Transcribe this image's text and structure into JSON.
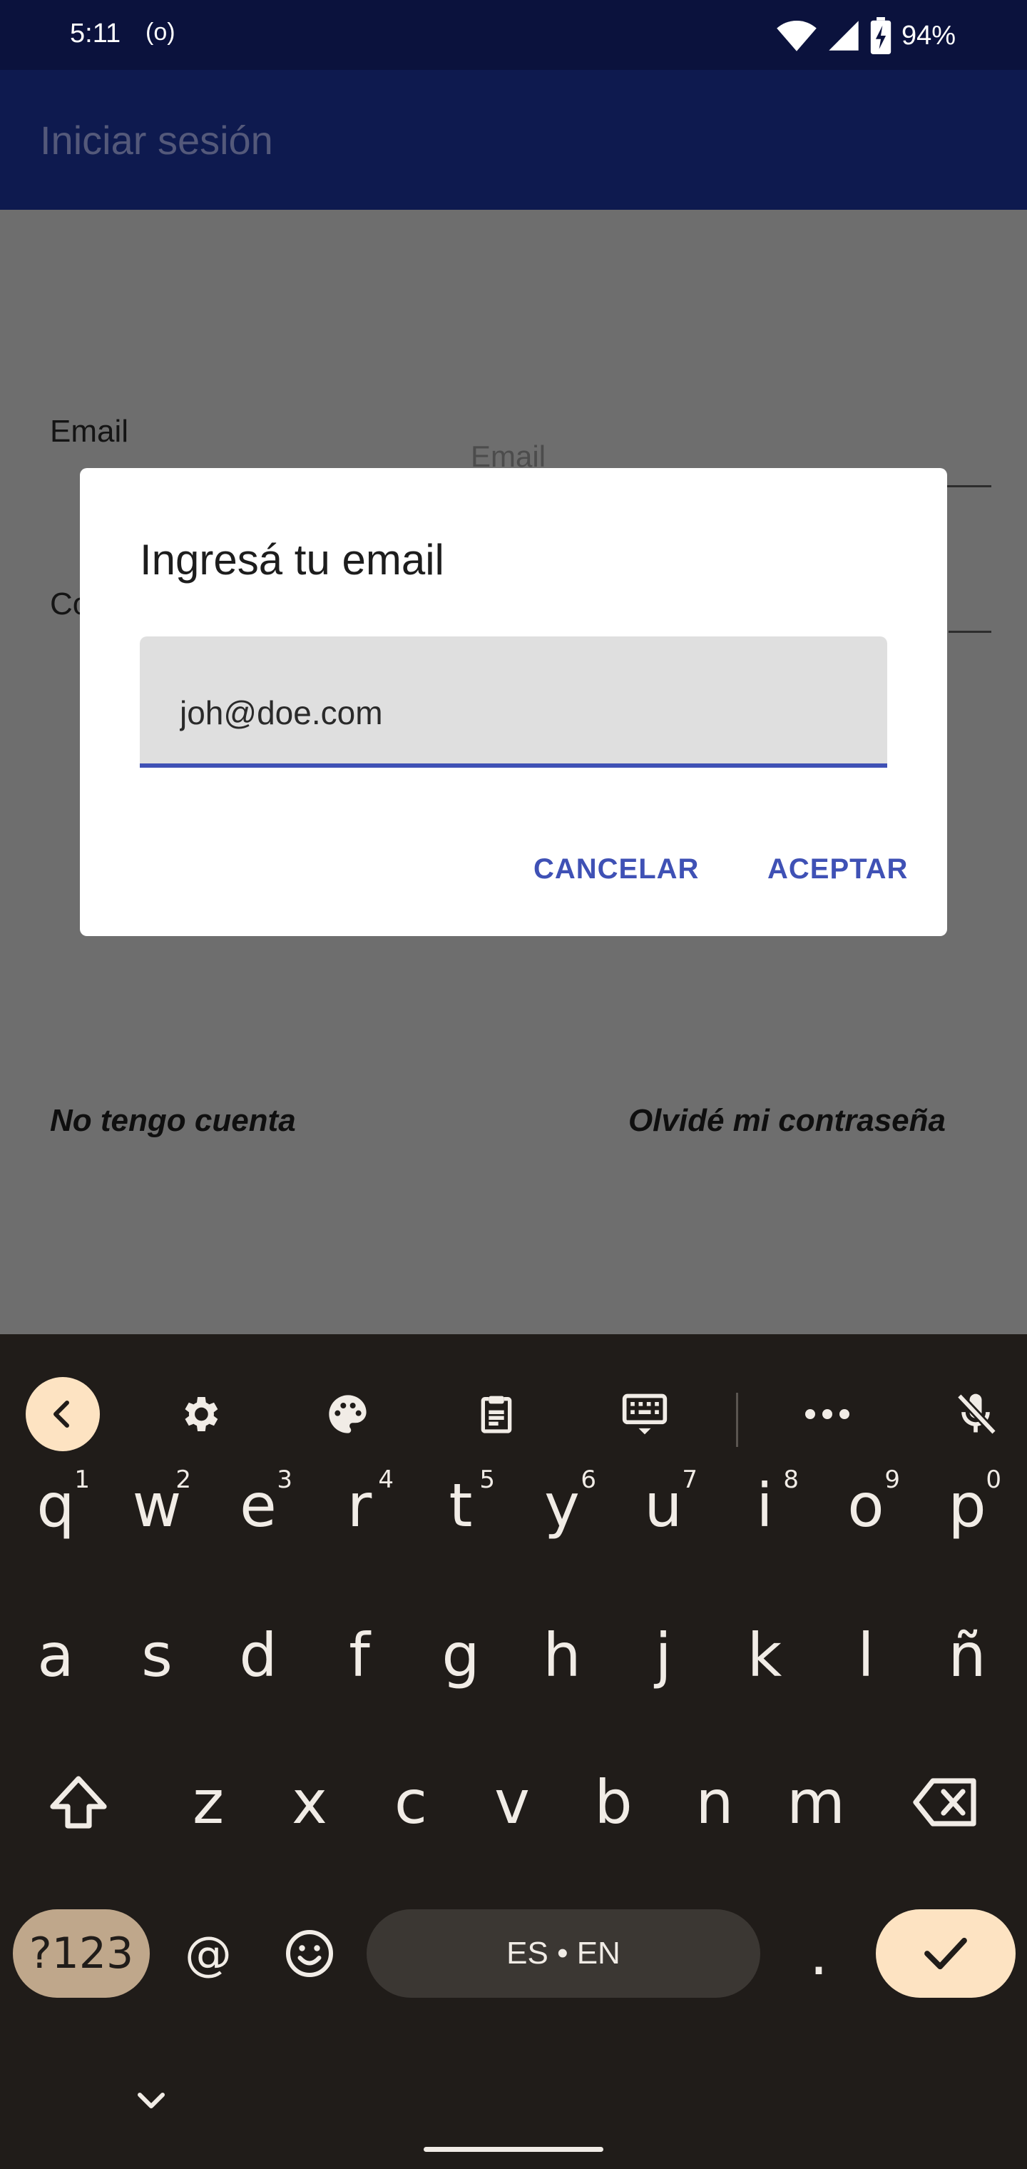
{
  "status_bar": {
    "time": "5:11",
    "hotspot": "(o)",
    "battery": "94%"
  },
  "app_bar": {
    "title": "Iniciar sesión"
  },
  "form": {
    "email_label": "Email",
    "email_placeholder": "Email",
    "password_label_partial": "Co",
    "no_account_link": "No tengo cuenta",
    "forgot_password_link": "Olvidé mi contraseña"
  },
  "dialog": {
    "title": "Ingresá tu email",
    "email_value": "joh@doe.com",
    "cancel_label": "CANCELAR",
    "accept_label": "ACEPTAR"
  },
  "keyboard": {
    "toolbar": [
      "back-icon",
      "gear-icon",
      "palette-icon",
      "clipboard-icon",
      "keyboard-icon",
      "more-icon",
      "mic-off-icon"
    ],
    "row1": [
      {
        "char": "q",
        "sup": "1"
      },
      {
        "char": "w",
        "sup": "2"
      },
      {
        "char": "e",
        "sup": "3"
      },
      {
        "char": "r",
        "sup": "4"
      },
      {
        "char": "t",
        "sup": "5"
      },
      {
        "char": "y",
        "sup": "6"
      },
      {
        "char": "u",
        "sup": "7"
      },
      {
        "char": "i",
        "sup": "8"
      },
      {
        "char": "o",
        "sup": "9"
      },
      {
        "char": "p",
        "sup": "0"
      }
    ],
    "row2": [
      "a",
      "s",
      "d",
      "f",
      "g",
      "h",
      "j",
      "k",
      "l",
      "ñ"
    ],
    "row3": [
      "z",
      "x",
      "c",
      "v",
      "b",
      "n",
      "m"
    ],
    "numbers_key": "?123",
    "at_key": "@",
    "space_label": "ES • EN",
    "period_key": ".",
    "accent_color": "#fde3c2",
    "numbers_key_color": "#bfa78b"
  }
}
